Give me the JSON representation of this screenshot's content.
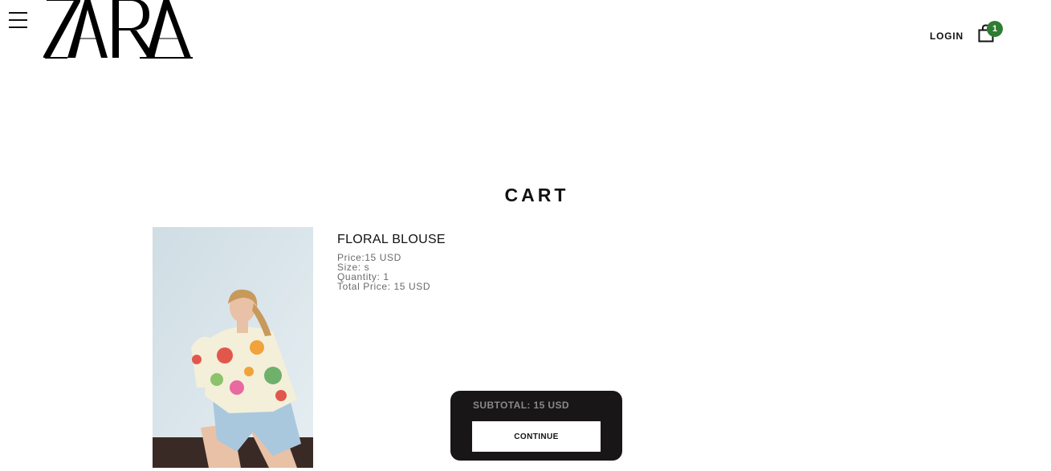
{
  "header": {
    "brand": "ZARA",
    "login_label": "LOGIN",
    "cart_count": "1"
  },
  "cart": {
    "title": "CART",
    "items": [
      {
        "name": "FLORAL BLOUSE",
        "price": "Price:15 USD",
        "size": "Size: s",
        "quantity": "Quantity: 1",
        "total_price": "Total Price: 15 USD"
      }
    ]
  },
  "summary": {
    "subtotal": "SUBTOTAL: 15 USD",
    "continue_label": "CONTINUE"
  },
  "colors": {
    "badge": "#2e7d32",
    "summary_bg": "#181616"
  }
}
